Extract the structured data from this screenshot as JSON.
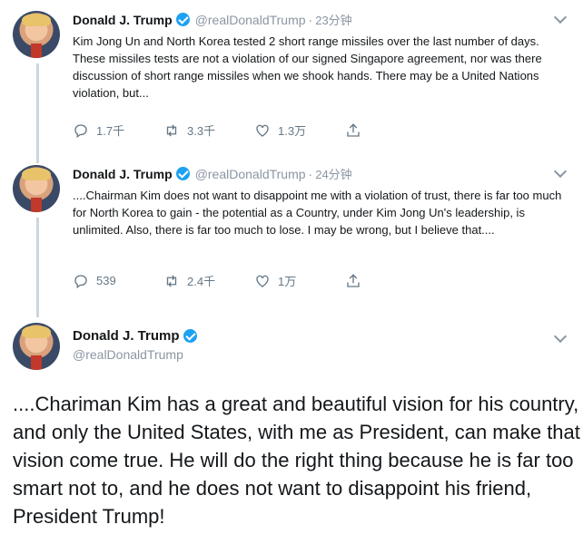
{
  "tweets": [
    {
      "name": "Donald J. Trump",
      "handle": "@realDonaldTrump",
      "time": "23分钟",
      "text": "Kim Jong Un and North Korea tested 2 short range missiles over the last number of days. These missiles tests are not a violation of our signed Singapore agreement, nor was there discussion of short range missiles when we shook hands. There may be a United Nations violation, but...",
      "replies": "1.7千",
      "retweets": "3.3千",
      "likes": "1.3万"
    },
    {
      "name": "Donald J. Trump",
      "handle": "@realDonaldTrump",
      "time": "24分钟",
      "text": "....Chairman Kim does not want to disappoint me with a violation of trust, there is far too much for North Korea to gain - the potential as a Country, under Kim Jong Un's leadership, is unlimited. Also, there is far too much to lose. I may be wrong, but I believe that....",
      "replies": "539",
      "retweets": "2.4千",
      "likes": "1万"
    }
  ],
  "main_tweet": {
    "name": "Donald J. Trump",
    "handle": "@realDonaldTrump",
    "text": "....Chariman Kim has a great and beautiful vision for his country, and only the United States, with me as President, can make that vision come true. He will do the right thing because he is far too smart not to, and he does not want to disappoint his friend, President Trump!"
  },
  "icons": {
    "reply": "reply-icon",
    "retweet": "retweet-icon",
    "like": "heart-icon",
    "share": "share-icon",
    "verified": "verified-badge-icon",
    "more": "chevron-down-icon"
  },
  "colors": {
    "verified": "#1da1f2",
    "secondary_text": "#8a96a3",
    "thread_line": "#ccd6dd"
  }
}
